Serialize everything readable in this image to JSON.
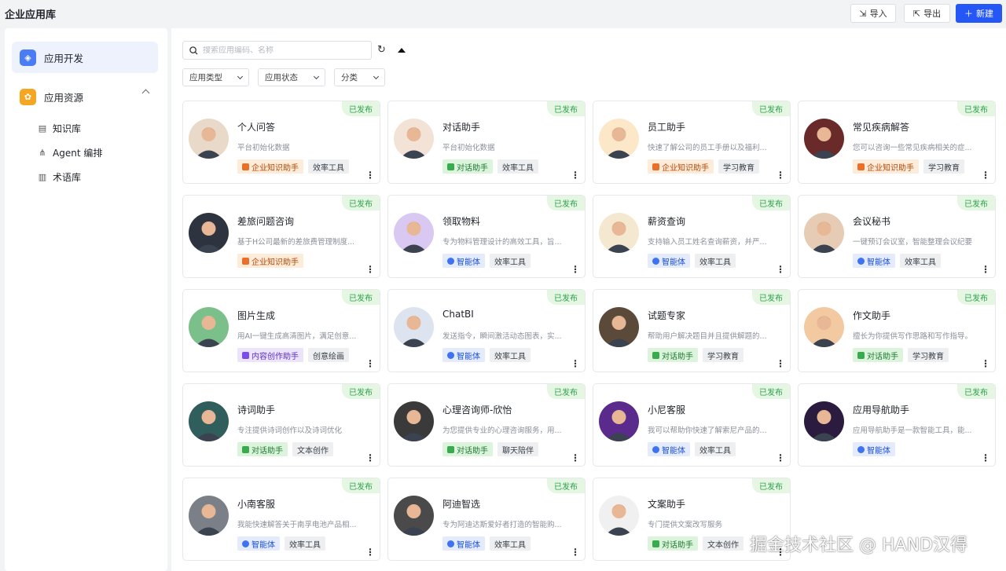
{
  "page": {
    "title": "企业应用库"
  },
  "toolbar": {
    "import_label": "导入",
    "export_label": "导出",
    "new_label": "新建"
  },
  "sidebar": {
    "app_dev": "应用开发",
    "app_res": "应用资源",
    "sub_items": [
      "知识库",
      "Agent 编排",
      "术语库"
    ]
  },
  "search": {
    "placeholder": "搜索应用编码、名称"
  },
  "filters": [
    "应用类型",
    "应用状态",
    "分类"
  ],
  "cards": [
    {
      "name": "个人问答",
      "desc": "平台初始化数据",
      "status": "已发布",
      "tags": [
        {
          "label": "企业知识助手",
          "color": "orange"
        },
        {
          "label": "效率工具",
          "color": "gray"
        }
      ]
    },
    {
      "name": "对话助手",
      "desc": "平台初始化数据",
      "status": "已发布",
      "tags": [
        {
          "label": "对话助手",
          "color": "green"
        },
        {
          "label": "效率工具",
          "color": "gray"
        }
      ]
    },
    {
      "name": "员工助手",
      "desc": "快速了解公司的员工手册以及福利...",
      "status": "已发布",
      "tags": [
        {
          "label": "企业知识助手",
          "color": "orange"
        },
        {
          "label": "学习教育",
          "color": "gray"
        }
      ]
    },
    {
      "name": "常见疾病解答",
      "desc": "您可以咨询一些常见疾病相关的症...",
      "status": "已发布",
      "tags": [
        {
          "label": "企业知识助手",
          "color": "orange"
        },
        {
          "label": "学习教育",
          "color": "gray"
        }
      ]
    },
    {
      "name": "差旅问题咨询",
      "desc": "基于H公司最新的差旅费管理制度...",
      "status": "已发布",
      "tags": [
        {
          "label": "企业知识助手",
          "color": "orange"
        }
      ]
    },
    {
      "name": "领取物料",
      "desc": "专为物料管理设计的高效工具，旨...",
      "status": "已发布",
      "tags": [
        {
          "label": "智能体",
          "color": "blue"
        },
        {
          "label": "效率工具",
          "color": "gray"
        }
      ]
    },
    {
      "name": "薪资查询",
      "desc": "支持输入员工姓名查询薪资，并严...",
      "status": "已发布",
      "tags": [
        {
          "label": "智能体",
          "color": "blue"
        },
        {
          "label": "效率工具",
          "color": "gray"
        }
      ]
    },
    {
      "name": "会议秘书",
      "desc": "一键预订会议室，智能整理会议纪要",
      "status": "已发布",
      "tags": [
        {
          "label": "智能体",
          "color": "blue"
        },
        {
          "label": "效率工具",
          "color": "gray"
        }
      ]
    },
    {
      "name": "图片生成",
      "desc": "用AI一键生成高清图片，满足创意...",
      "status": "已发布",
      "tags": [
        {
          "label": "内容创作助手",
          "color": "purple"
        },
        {
          "label": "创意绘画",
          "color": "gray"
        }
      ]
    },
    {
      "name": "ChatBI",
      "desc": "发送指令，瞬间激活动态图表，实...",
      "status": "已发布",
      "tags": [
        {
          "label": "智能体",
          "color": "blue"
        },
        {
          "label": "效率工具",
          "color": "gray"
        }
      ]
    },
    {
      "name": "试题专家",
      "desc": "帮助用户解决题目并且提供解题的...",
      "status": "已发布",
      "tags": [
        {
          "label": "对话助手",
          "color": "green"
        },
        {
          "label": "学习教育",
          "color": "gray"
        }
      ]
    },
    {
      "name": "作文助手",
      "desc": "擅长为你提供写作思路和写作指导。",
      "status": "已发布",
      "tags": [
        {
          "label": "对话助手",
          "color": "green"
        },
        {
          "label": "学习教育",
          "color": "gray"
        }
      ]
    },
    {
      "name": "诗词助手",
      "desc": "专注提供诗词创作以及诗词优化",
      "status": "已发布",
      "tags": [
        {
          "label": "对话助手",
          "color": "green"
        },
        {
          "label": "文本创作",
          "color": "gray"
        }
      ]
    },
    {
      "name": "心理咨询师-欣怡",
      "desc": "为您提供专业的心理咨询服务，用...",
      "status": "已发布",
      "tags": [
        {
          "label": "对话助手",
          "color": "green"
        },
        {
          "label": "聊天陪伴",
          "color": "gray"
        }
      ]
    },
    {
      "name": "小尼客服",
      "desc": "我可以帮助你快速了解索尼产品的...",
      "status": "已发布",
      "tags": [
        {
          "label": "智能体",
          "color": "blue"
        },
        {
          "label": "效率工具",
          "color": "gray"
        }
      ]
    },
    {
      "name": "应用导航助手",
      "desc": "应用导航助手是一款智能工具，能...",
      "status": "已发布",
      "tags": [
        {
          "label": "智能体",
          "color": "blue"
        }
      ]
    },
    {
      "name": "小南客服",
      "desc": "我能快速解答关于南孚电池产品相...",
      "status": "已发布",
      "tags": [
        {
          "label": "智能体",
          "color": "blue"
        },
        {
          "label": "效率工具",
          "color": "gray"
        }
      ]
    },
    {
      "name": "阿迪智选",
      "desc": "专为阿迪达斯爱好者打造的智能购...",
      "status": "已发布",
      "tags": [
        {
          "label": "智能体",
          "color": "blue"
        },
        {
          "label": "效率工具",
          "color": "gray"
        }
      ]
    },
    {
      "name": "文案助手",
      "desc": "专门提供文案改写服务",
      "status": "已发布",
      "tags": [
        {
          "label": "对话助手",
          "color": "green"
        },
        {
          "label": "文本创作",
          "color": "gray"
        }
      ]
    }
  ],
  "colors": {
    "accent": "#2457f5",
    "published": "#2ea14d"
  },
  "avatar_palette": [
    "#e9d9c8",
    "#f3e2d6",
    "#fce8c8",
    "#6b2a2a",
    "#2d3440",
    "#d9c9f2",
    "#f4e9d0",
    "#e6cbb5",
    "#7bbf8a",
    "#dde4f0",
    "#5b4a3a",
    "#f2c9a0",
    "#2f5e5c",
    "#3a3a3a",
    "#5a2a8c",
    "#2b1b3f",
    "#7a7f88",
    "#4a4a4a",
    "#f0f0f0"
  ],
  "watermark": "掘金技术社区 @ HAND汉得"
}
